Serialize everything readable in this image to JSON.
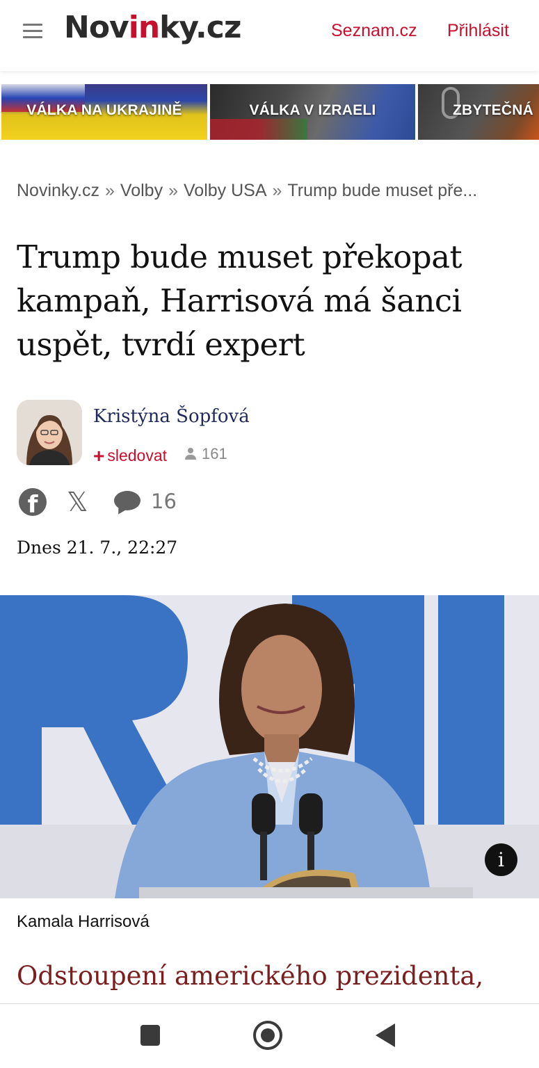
{
  "header": {
    "logo_prefix": "Nov",
    "logo_accent": "in",
    "logo_suffix": "ky.cz",
    "seznam_link": "Seznam.cz",
    "login_link": "Přihlásit"
  },
  "banners": [
    {
      "label": "VÁLKA NA UKRAJINĚ"
    },
    {
      "label": "VÁLKA V IZRAELI"
    },
    {
      "label": "ZBYTEČNÁ"
    }
  ],
  "breadcrumb": {
    "items": [
      "Novinky.cz",
      "Volby",
      "Volby USA",
      "Trump bude muset pře..."
    ],
    "separator": "»"
  },
  "article": {
    "title": "Trump bude muset překopat kampaň, Harrisová má šanci uspět, tvrdí expert",
    "author_name": "Kristýna Šopfová",
    "follow_plus": "+",
    "follow_label": "sledovat",
    "followers_count": "161",
    "comments_count": "16",
    "date": "Dnes 21. 7., 22:27",
    "image_caption": "Kamala Harrisová",
    "lead_start": "Odstoupení amerického prezidenta,"
  },
  "icons": {
    "facebook": "facebook-icon",
    "x": "x-icon",
    "comment": "comment-icon",
    "info_glyph": "i"
  },
  "colors": {
    "accent": "#c8102e",
    "author_link": "#1f2a5c",
    "lead_text": "#7a1e1e"
  }
}
